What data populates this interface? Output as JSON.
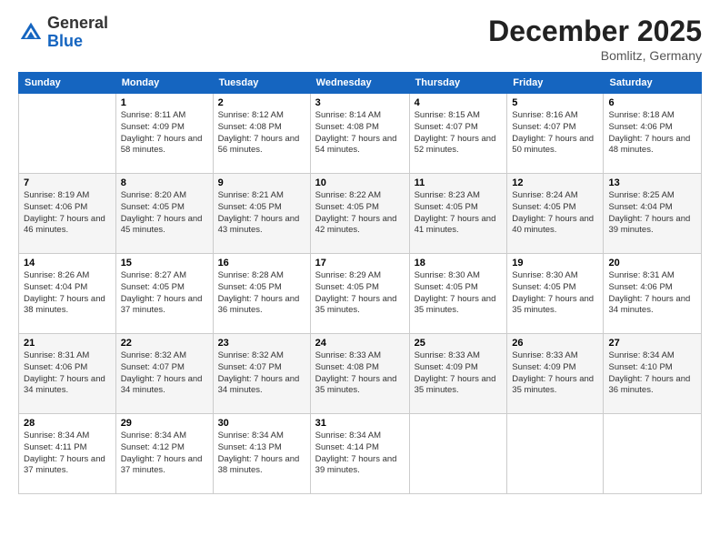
{
  "header": {
    "logo_general": "General",
    "logo_blue": "Blue",
    "month_title": "December 2025",
    "location": "Bomlitz, Germany"
  },
  "weekdays": [
    "Sunday",
    "Monday",
    "Tuesday",
    "Wednesday",
    "Thursday",
    "Friday",
    "Saturday"
  ],
  "weeks": [
    [
      {
        "day": "",
        "sunrise": "",
        "sunset": "",
        "daylight": ""
      },
      {
        "day": "1",
        "sunrise": "Sunrise: 8:11 AM",
        "sunset": "Sunset: 4:09 PM",
        "daylight": "Daylight: 7 hours and 58 minutes."
      },
      {
        "day": "2",
        "sunrise": "Sunrise: 8:12 AM",
        "sunset": "Sunset: 4:08 PM",
        "daylight": "Daylight: 7 hours and 56 minutes."
      },
      {
        "day": "3",
        "sunrise": "Sunrise: 8:14 AM",
        "sunset": "Sunset: 4:08 PM",
        "daylight": "Daylight: 7 hours and 54 minutes."
      },
      {
        "day": "4",
        "sunrise": "Sunrise: 8:15 AM",
        "sunset": "Sunset: 4:07 PM",
        "daylight": "Daylight: 7 hours and 52 minutes."
      },
      {
        "day": "5",
        "sunrise": "Sunrise: 8:16 AM",
        "sunset": "Sunset: 4:07 PM",
        "daylight": "Daylight: 7 hours and 50 minutes."
      },
      {
        "day": "6",
        "sunrise": "Sunrise: 8:18 AM",
        "sunset": "Sunset: 4:06 PM",
        "daylight": "Daylight: 7 hours and 48 minutes."
      }
    ],
    [
      {
        "day": "7",
        "sunrise": "Sunrise: 8:19 AM",
        "sunset": "Sunset: 4:06 PM",
        "daylight": "Daylight: 7 hours and 46 minutes."
      },
      {
        "day": "8",
        "sunrise": "Sunrise: 8:20 AM",
        "sunset": "Sunset: 4:05 PM",
        "daylight": "Daylight: 7 hours and 45 minutes."
      },
      {
        "day": "9",
        "sunrise": "Sunrise: 8:21 AM",
        "sunset": "Sunset: 4:05 PM",
        "daylight": "Daylight: 7 hours and 43 minutes."
      },
      {
        "day": "10",
        "sunrise": "Sunrise: 8:22 AM",
        "sunset": "Sunset: 4:05 PM",
        "daylight": "Daylight: 7 hours and 42 minutes."
      },
      {
        "day": "11",
        "sunrise": "Sunrise: 8:23 AM",
        "sunset": "Sunset: 4:05 PM",
        "daylight": "Daylight: 7 hours and 41 minutes."
      },
      {
        "day": "12",
        "sunrise": "Sunrise: 8:24 AM",
        "sunset": "Sunset: 4:05 PM",
        "daylight": "Daylight: 7 hours and 40 minutes."
      },
      {
        "day": "13",
        "sunrise": "Sunrise: 8:25 AM",
        "sunset": "Sunset: 4:04 PM",
        "daylight": "Daylight: 7 hours and 39 minutes."
      }
    ],
    [
      {
        "day": "14",
        "sunrise": "Sunrise: 8:26 AM",
        "sunset": "Sunset: 4:04 PM",
        "daylight": "Daylight: 7 hours and 38 minutes."
      },
      {
        "day": "15",
        "sunrise": "Sunrise: 8:27 AM",
        "sunset": "Sunset: 4:05 PM",
        "daylight": "Daylight: 7 hours and 37 minutes."
      },
      {
        "day": "16",
        "sunrise": "Sunrise: 8:28 AM",
        "sunset": "Sunset: 4:05 PM",
        "daylight": "Daylight: 7 hours and 36 minutes."
      },
      {
        "day": "17",
        "sunrise": "Sunrise: 8:29 AM",
        "sunset": "Sunset: 4:05 PM",
        "daylight": "Daylight: 7 hours and 35 minutes."
      },
      {
        "day": "18",
        "sunrise": "Sunrise: 8:30 AM",
        "sunset": "Sunset: 4:05 PM",
        "daylight": "Daylight: 7 hours and 35 minutes."
      },
      {
        "day": "19",
        "sunrise": "Sunrise: 8:30 AM",
        "sunset": "Sunset: 4:05 PM",
        "daylight": "Daylight: 7 hours and 35 minutes."
      },
      {
        "day": "20",
        "sunrise": "Sunrise: 8:31 AM",
        "sunset": "Sunset: 4:06 PM",
        "daylight": "Daylight: 7 hours and 34 minutes."
      }
    ],
    [
      {
        "day": "21",
        "sunrise": "Sunrise: 8:31 AM",
        "sunset": "Sunset: 4:06 PM",
        "daylight": "Daylight: 7 hours and 34 minutes."
      },
      {
        "day": "22",
        "sunrise": "Sunrise: 8:32 AM",
        "sunset": "Sunset: 4:07 PM",
        "daylight": "Daylight: 7 hours and 34 minutes."
      },
      {
        "day": "23",
        "sunrise": "Sunrise: 8:32 AM",
        "sunset": "Sunset: 4:07 PM",
        "daylight": "Daylight: 7 hours and 34 minutes."
      },
      {
        "day": "24",
        "sunrise": "Sunrise: 8:33 AM",
        "sunset": "Sunset: 4:08 PM",
        "daylight": "Daylight: 7 hours and 35 minutes."
      },
      {
        "day": "25",
        "sunrise": "Sunrise: 8:33 AM",
        "sunset": "Sunset: 4:09 PM",
        "daylight": "Daylight: 7 hours and 35 minutes."
      },
      {
        "day": "26",
        "sunrise": "Sunrise: 8:33 AM",
        "sunset": "Sunset: 4:09 PM",
        "daylight": "Daylight: 7 hours and 35 minutes."
      },
      {
        "day": "27",
        "sunrise": "Sunrise: 8:34 AM",
        "sunset": "Sunset: 4:10 PM",
        "daylight": "Daylight: 7 hours and 36 minutes."
      }
    ],
    [
      {
        "day": "28",
        "sunrise": "Sunrise: 8:34 AM",
        "sunset": "Sunset: 4:11 PM",
        "daylight": "Daylight: 7 hours and 37 minutes."
      },
      {
        "day": "29",
        "sunrise": "Sunrise: 8:34 AM",
        "sunset": "Sunset: 4:12 PM",
        "daylight": "Daylight: 7 hours and 37 minutes."
      },
      {
        "day": "30",
        "sunrise": "Sunrise: 8:34 AM",
        "sunset": "Sunset: 4:13 PM",
        "daylight": "Daylight: 7 hours and 38 minutes."
      },
      {
        "day": "31",
        "sunrise": "Sunrise: 8:34 AM",
        "sunset": "Sunset: 4:14 PM",
        "daylight": "Daylight: 7 hours and 39 minutes."
      },
      {
        "day": "",
        "sunrise": "",
        "sunset": "",
        "daylight": ""
      },
      {
        "day": "",
        "sunrise": "",
        "sunset": "",
        "daylight": ""
      },
      {
        "day": "",
        "sunrise": "",
        "sunset": "",
        "daylight": ""
      }
    ]
  ]
}
